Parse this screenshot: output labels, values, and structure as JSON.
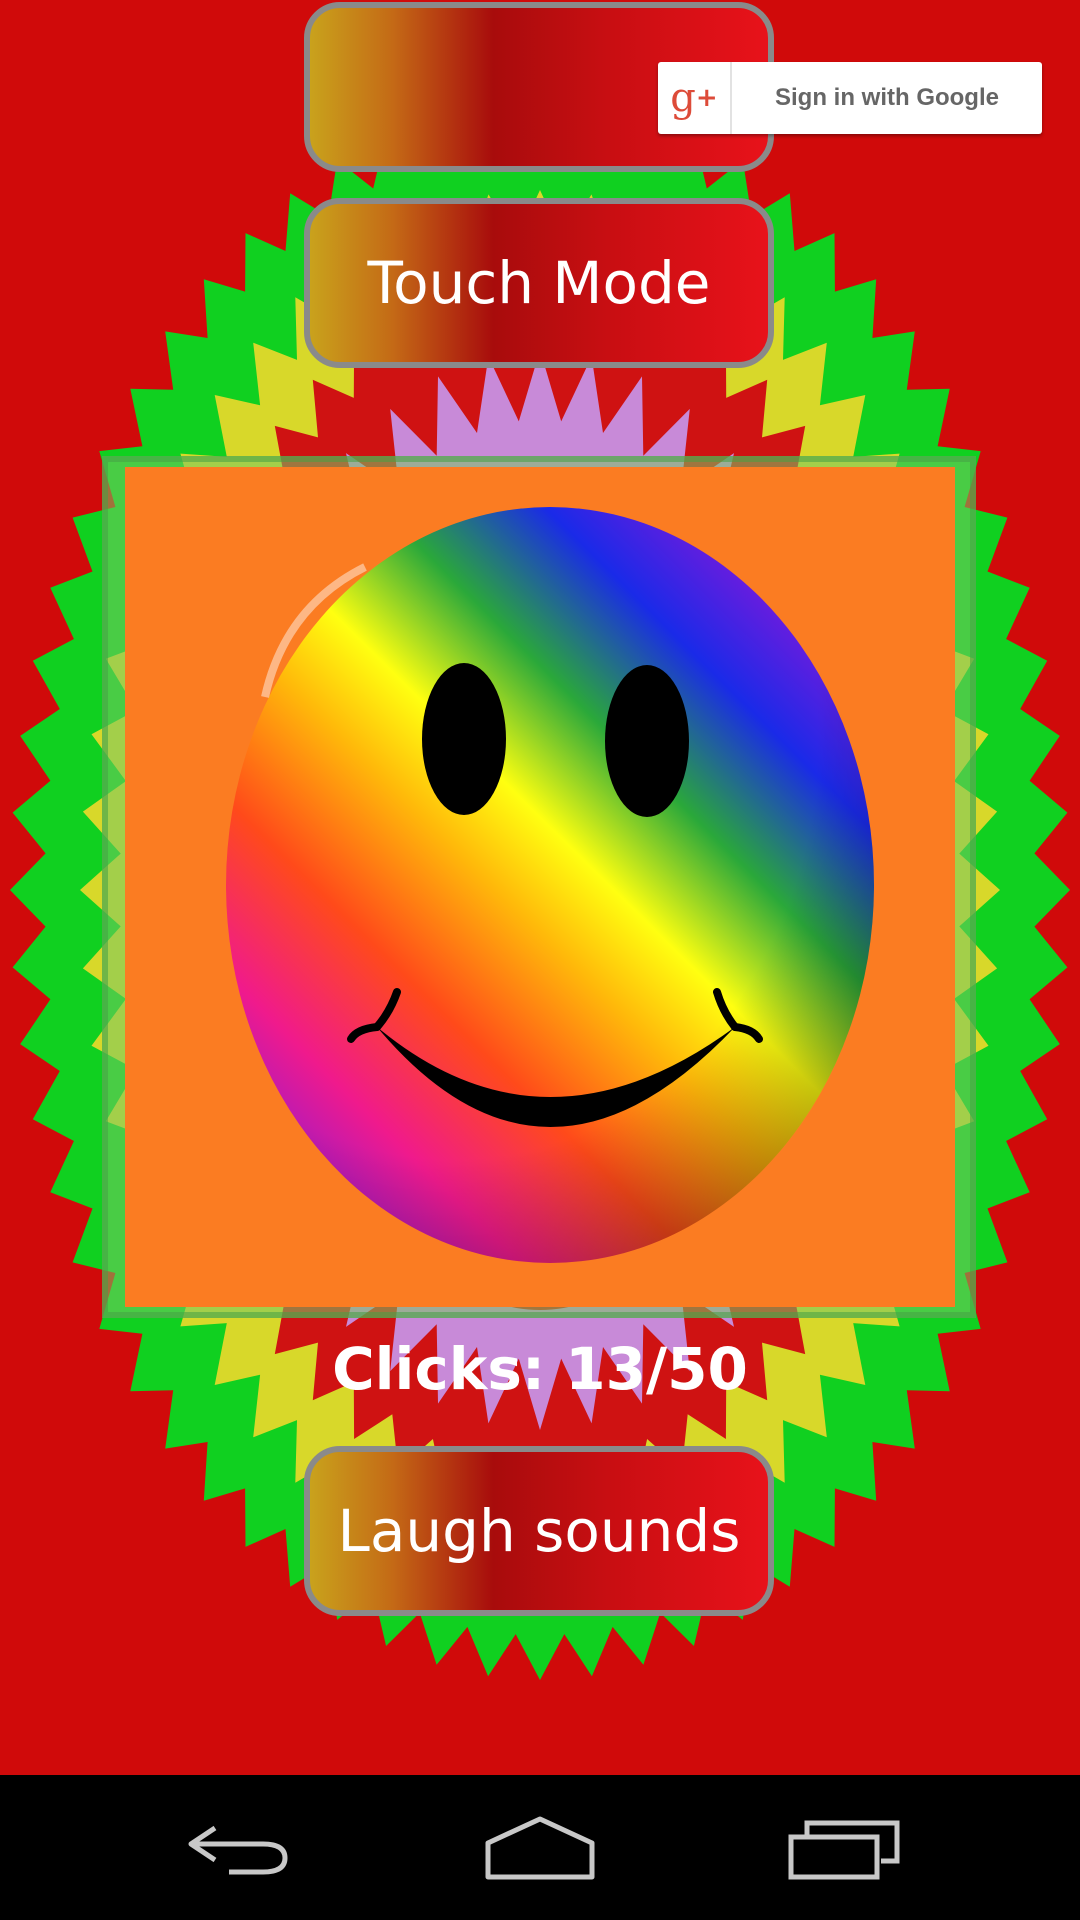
{
  "google_signin": {
    "logo_text": "g",
    "logo_plus": "+",
    "label": "Sign in with Google",
    "icon": "google-plus-icon"
  },
  "buttons": {
    "touch_mode": "Touch Mode",
    "laugh_sounds": "Laugh sounds"
  },
  "game": {
    "clicks_text": "Clicks: 13/50",
    "clicks": 13,
    "clicks_max": 50,
    "image": "rainbow-smiley-face"
  },
  "navigation": {
    "back_icon": "back-icon",
    "home_icon": "home-icon",
    "recents_icon": "recent-apps-icon"
  },
  "colors": {
    "background": "#d00a0a",
    "panel": "#fb7c22",
    "burst_green": "#10d020",
    "burst_yellow": "#d8d82a",
    "burst_lilac": "#c88ad8",
    "button_border": "#8a8a8a",
    "nav_bar": "#000000"
  }
}
